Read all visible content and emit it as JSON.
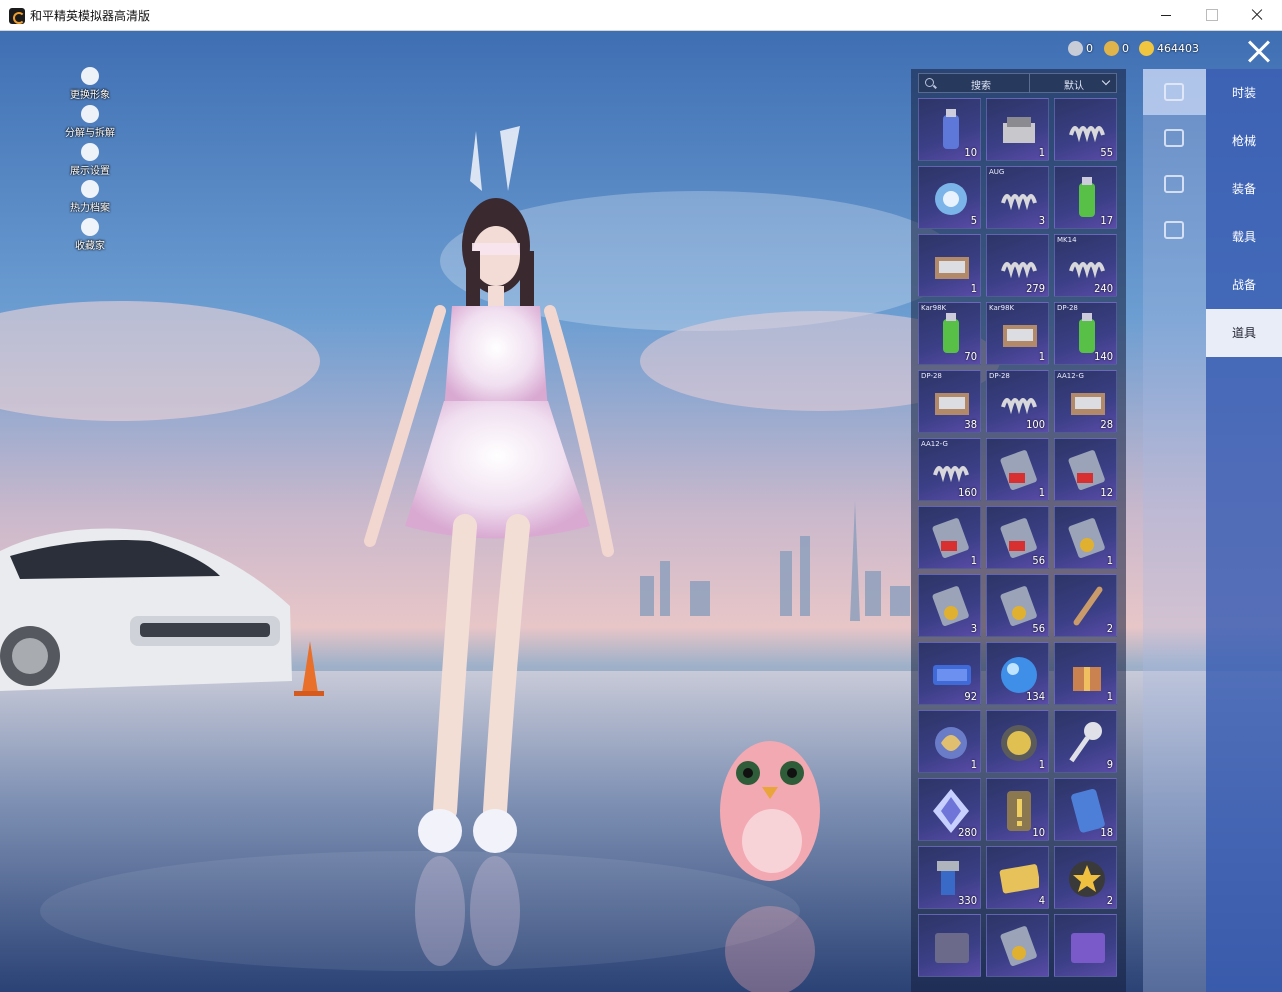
{
  "window": {
    "title": "和平精英模拟器高清版"
  },
  "left_menu": [
    {
      "label": "更换形象",
      "icon": "person-icon"
    },
    {
      "label": "分解与拆解",
      "icon": "puzzle-icon"
    },
    {
      "label": "展示设置",
      "icon": "eye-icon"
    },
    {
      "label": "热力档案",
      "icon": "flame-icon"
    },
    {
      "label": "收藏家",
      "icon": "collector-badge-icon"
    }
  ],
  "currency": [
    {
      "name": "coupon",
      "value": "0",
      "color": "#c7ccd6"
    },
    {
      "name": "token",
      "value": "0",
      "color": "#e0b44a"
    },
    {
      "name": "gold",
      "value": "464403",
      "color": "#f0c640"
    }
  ],
  "inventory": {
    "search_label": "搜索",
    "sort_label": "默认",
    "items": [
      {
        "icon": "spray-can-blue",
        "tag": "",
        "count": "10"
      },
      {
        "icon": "parts-box",
        "tag": "",
        "count": "1"
      },
      {
        "icon": "spring",
        "tag": "",
        "count": "55"
      },
      {
        "icon": "disc-badge",
        "tag": "",
        "count": "5"
      },
      {
        "icon": "spring",
        "tag": "AUG",
        "count": "3"
      },
      {
        "icon": "spray-can-green",
        "tag": "",
        "count": "17"
      },
      {
        "icon": "metal-case",
        "tag": "",
        "count": "1"
      },
      {
        "icon": "spring",
        "tag": "",
        "count": "279"
      },
      {
        "icon": "spring",
        "tag": "MK14",
        "count": "240"
      },
      {
        "icon": "spray-can-green",
        "tag": "Kar98K",
        "count": "70"
      },
      {
        "icon": "metal-case",
        "tag": "Kar98K",
        "count": "1"
      },
      {
        "icon": "spray-can-green",
        "tag": "DP-28",
        "count": "140"
      },
      {
        "icon": "metal-case",
        "tag": "DP-28",
        "count": "38"
      },
      {
        "icon": "spring",
        "tag": "DP-28",
        "count": "100"
      },
      {
        "icon": "metal-case",
        "tag": "AA12-G",
        "count": "28"
      },
      {
        "icon": "spring",
        "tag": "AA12-G",
        "count": "160"
      },
      {
        "icon": "card-red",
        "tag": "",
        "count": "1"
      },
      {
        "icon": "card-red",
        "tag": "",
        "count": "12"
      },
      {
        "icon": "card-red",
        "tag": "",
        "count": "1"
      },
      {
        "icon": "card-red",
        "tag": "",
        "count": "56"
      },
      {
        "icon": "card-gold",
        "tag": "",
        "count": "1"
      },
      {
        "icon": "card-gold",
        "tag": "",
        "count": "3"
      },
      {
        "icon": "card-gold",
        "tag": "",
        "count": "56"
      },
      {
        "icon": "baton",
        "tag": "",
        "count": "2"
      },
      {
        "icon": "ticket-blue",
        "tag": "",
        "count": "92"
      },
      {
        "icon": "orb-blue",
        "tag": "",
        "count": "134"
      },
      {
        "icon": "gift-box",
        "tag": "",
        "count": "1"
      },
      {
        "icon": "dragon-emblem",
        "tag": "",
        "count": "1"
      },
      {
        "icon": "puzzle-coin",
        "tag": "",
        "count": "1"
      },
      {
        "icon": "key",
        "tag": "",
        "count": "9"
      },
      {
        "icon": "diamond",
        "tag": "",
        "count": "280"
      },
      {
        "icon": "exclaim-card",
        "tag": "",
        "count": "10"
      },
      {
        "icon": "card-blue",
        "tag": "",
        "count": "18"
      },
      {
        "icon": "spray-gun",
        "tag": "",
        "count": "330"
      },
      {
        "icon": "ticket-ss40",
        "tag": "",
        "count": "4"
      },
      {
        "icon": "star-coin",
        "tag": "",
        "count": "2"
      },
      {
        "icon": "card-dark",
        "tag": "",
        "count": ""
      },
      {
        "icon": "card-gold",
        "tag": "",
        "count": ""
      },
      {
        "icon": "card-purple",
        "tag": "",
        "count": ""
      }
    ]
  },
  "icon_tabs": [
    {
      "icon": "card-tab-icon",
      "active": true
    },
    {
      "icon": "calendar-tab-icon",
      "active": false
    },
    {
      "icon": "sparkle-tab-icon",
      "active": false
    },
    {
      "icon": "ticket-tab-icon",
      "active": false
    }
  ],
  "category_tabs": [
    {
      "label": "时装",
      "active": false
    },
    {
      "label": "枪械",
      "active": false
    },
    {
      "label": "装备",
      "active": false
    },
    {
      "label": "载具",
      "active": false
    },
    {
      "label": "战备",
      "active": false
    },
    {
      "label": "道具",
      "active": true
    }
  ]
}
